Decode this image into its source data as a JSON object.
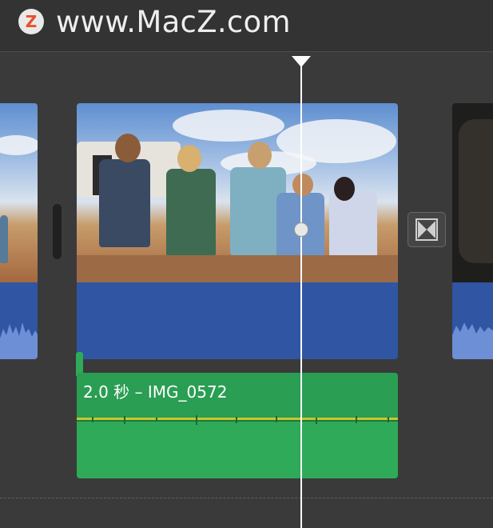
{
  "watermark": {
    "logo_letter": "Z",
    "text": "www.MacZ.com"
  },
  "timeline": {
    "audio_clip_label": "2.0 秒 – IMG_0572"
  },
  "colors": {
    "video_clip_blue": "#2f55a3",
    "audio_clip_green": "#2faa58",
    "playhead": "#ffffff",
    "logo_accent": "#e8512d"
  },
  "icons": {
    "transition": "bowtie-transition-icon",
    "playhead": "playhead-triangle-icon"
  }
}
